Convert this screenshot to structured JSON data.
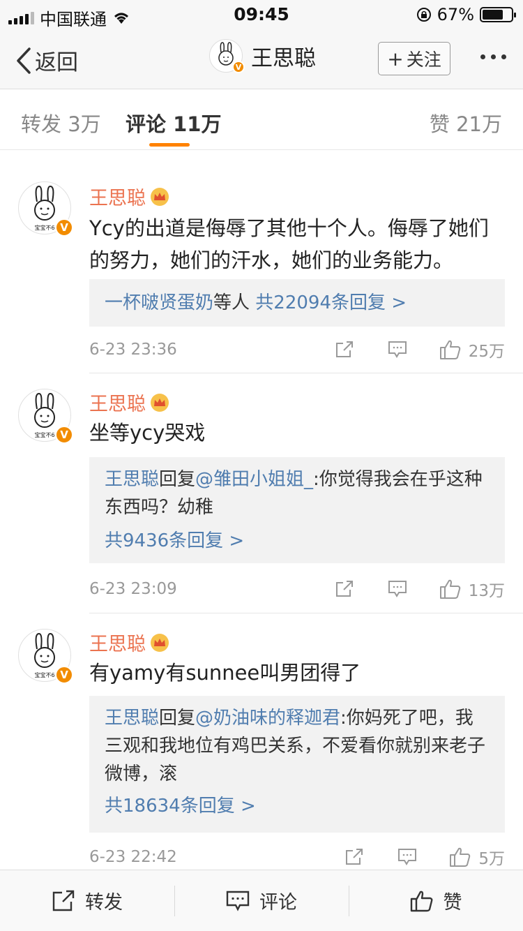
{
  "status_bar": {
    "carrier": "中国联通",
    "time": "09:45",
    "battery": "67%"
  },
  "nav": {
    "back_label": "返回",
    "title": "王思聪",
    "follow_label": "关注"
  },
  "tabs": {
    "repost_label": "转发",
    "repost_count": "3万",
    "comment_label": "评论",
    "comment_count": "11万",
    "like_label": "赞",
    "like_count": "21万"
  },
  "comments": [
    {
      "author": "王思聪",
      "avatar_text": "宝宝不6",
      "text": "Ycy的出道是侮辱了其他十个人。侮辱了她们的努力，她们的汗水，她们的业务能力。",
      "reply_summary_user": "一杯啵贤蛋奶",
      "reply_summary_mid": "等人",
      "reply_count_label": "共22094条回复 >",
      "time": "6-23 23:36",
      "likes": "25万"
    },
    {
      "author": "王思聪",
      "avatar_text": "宝宝不6",
      "text": "坐等ycy哭戏",
      "reply_author": "王思聪",
      "reply_verb": "回复",
      "reply_target": "@雏田小姐姐_",
      "reply_text": ":你觉得我会在乎这种东西吗？幼稚",
      "reply_count_label": "共9436条回复 >",
      "time": "6-23 23:09",
      "likes": "13万"
    },
    {
      "author": "王思聪",
      "avatar_text": "宝宝不6",
      "text": "有yamy有sunnee叫男团得了",
      "reply_author": "王思聪",
      "reply_verb": "回复",
      "reply_target": "@奶油味的释迦君",
      "reply_text": ":你妈死了吧，我三观和我地位有鸡巴关系，不爱看你就别来老子微博，滚",
      "reply_count_label": "共18634条回复 >",
      "time": "6-23 22:42",
      "likes": "5万"
    }
  ],
  "bottom_bar": {
    "repost": "转发",
    "comment": "评论",
    "like": "赞"
  },
  "colors": {
    "accent_orange": "#ff8200",
    "username": "#eb7350",
    "link_blue": "#507daf",
    "verified_badge": "#f28c00"
  }
}
